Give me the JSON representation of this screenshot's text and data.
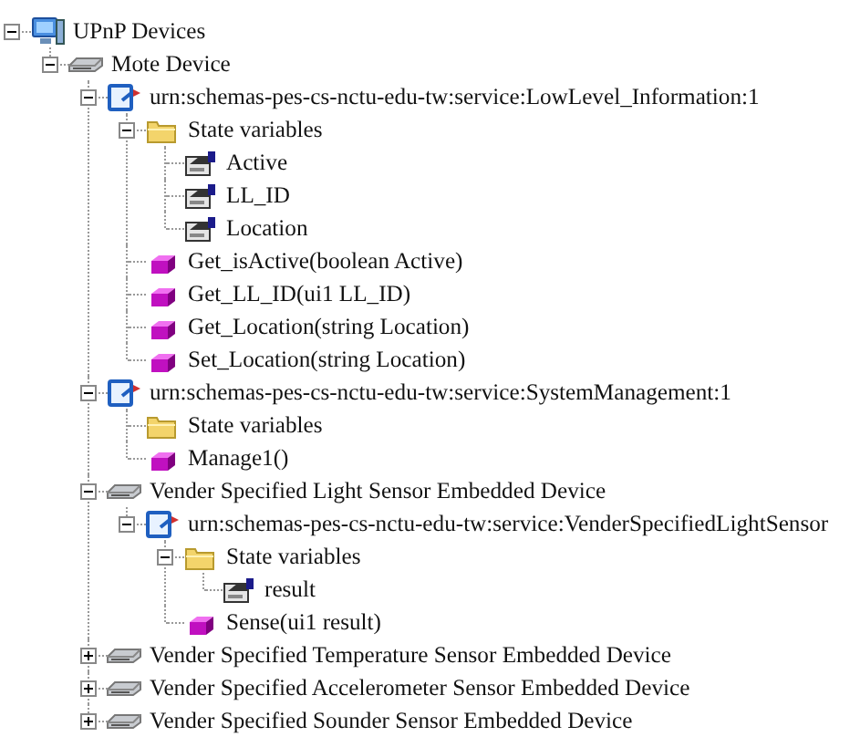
{
  "tree": [
    {
      "kind": "computer",
      "label": "UPnP Devices",
      "expanded": true,
      "children": [
        {
          "kind": "device",
          "label": "Mote Device",
          "expanded": true,
          "children": [
            {
              "kind": "service",
              "label": "urn:schemas-pes-cs-nctu-edu-tw:service:LowLevel_Information:1",
              "expanded": true,
              "children": [
                {
                  "kind": "folder",
                  "label": "State variables",
                  "expanded": true,
                  "children": [
                    {
                      "kind": "variable",
                      "label": "Active"
                    },
                    {
                      "kind": "variable",
                      "label": "LL_ID"
                    },
                    {
                      "kind": "variable",
                      "label": "Location"
                    }
                  ]
                },
                {
                  "kind": "action",
                  "label": "Get_isActive(boolean Active)"
                },
                {
                  "kind": "action",
                  "label": "Get_LL_ID(ui1 LL_ID)"
                },
                {
                  "kind": "action",
                  "label": "Get_Location(string Location)"
                },
                {
                  "kind": "action",
                  "label": "Set_Location(string Location)"
                }
              ]
            },
            {
              "kind": "service",
              "label": "urn:schemas-pes-cs-nctu-edu-tw:service:SystemManagement:1",
              "expanded": true,
              "children": [
                {
                  "kind": "folder",
                  "label": "State variables"
                },
                {
                  "kind": "action",
                  "label": "Manage1()"
                }
              ]
            },
            {
              "kind": "device",
              "label": "Vender Specified Light Sensor Embedded Device",
              "expanded": true,
              "children": [
                {
                  "kind": "service",
                  "label": "urn:schemas-pes-cs-nctu-edu-tw:service:VenderSpecifiedLightSensor",
                  "expanded": true,
                  "children": [
                    {
                      "kind": "folder",
                      "label": "State variables",
                      "expanded": true,
                      "children": [
                        {
                          "kind": "variable",
                          "label": "result"
                        }
                      ]
                    },
                    {
                      "kind": "action",
                      "label": "Sense(ui1 result)"
                    }
                  ]
                }
              ]
            },
            {
              "kind": "device",
              "label": "Vender Specified Temperature Sensor Embedded Device",
              "expanded": false
            },
            {
              "kind": "device",
              "label": "Vender Specified Accelerometer Sensor Embedded Device",
              "expanded": false
            },
            {
              "kind": "device",
              "label": "Vender Specified Sounder Sensor Embedded Device",
              "expanded": false
            }
          ]
        }
      ]
    }
  ]
}
